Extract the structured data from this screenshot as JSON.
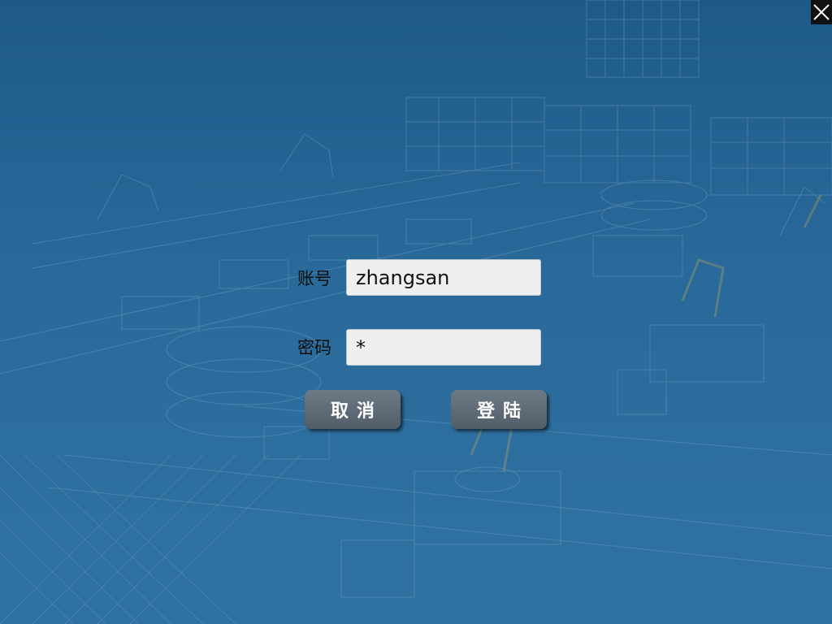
{
  "window": {
    "close_icon": "close-icon"
  },
  "login_form": {
    "account_label": "账号",
    "account_value": "zhangsan",
    "password_label": "密码",
    "password_value": "*",
    "cancel_label": "取消",
    "login_label": "登陆"
  },
  "colors": {
    "background": "#2a6a9a",
    "input_background": "#efefef",
    "button_background": "#5c6873",
    "button_text": "#ffffff",
    "close_button": "#111111"
  }
}
